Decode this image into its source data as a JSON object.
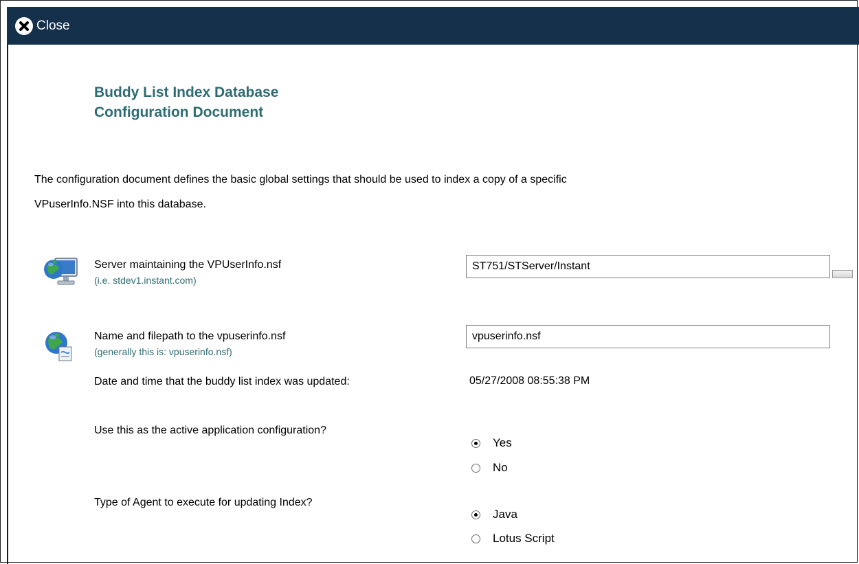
{
  "header": {
    "close_label": "Close"
  },
  "document": {
    "title_line1": "Buddy List Index Database",
    "title_line2": "Configuration Document",
    "intro_line1": "The configuration document defines the basic global settings that should be used to index a copy of a specific",
    "intro_line2": "VPuserInfo.NSF into this database."
  },
  "fields": {
    "server": {
      "label": "Server maintaining the VPUserInfo.nsf",
      "hint": "(i.e. stdev1.instant.com)",
      "value": "ST751/STServer/Instant",
      "icon": "network-computer-icon"
    },
    "filepath": {
      "label": "Name and filepath to the vpuserinfo.nsf",
      "hint": "(generally this is: vpuserinfo.nsf)",
      "value": "vpuserinfo.nsf",
      "icon": "globe-document-icon"
    },
    "updated": {
      "label": "Date and time that the buddy list index was updated:",
      "value": "05/27/2008 08:55:38 PM"
    },
    "active_config": {
      "label": "Use this as the active application configuration?",
      "options": [
        "Yes",
        "No"
      ],
      "selected": "Yes"
    },
    "agent_type": {
      "label": "Type of Agent to execute for updating Index?",
      "options": [
        "Java",
        "Lotus Script"
      ],
      "selected": "Java"
    }
  },
  "colors": {
    "header_bg": "#15304a",
    "accent_text": "#2e6b72"
  }
}
